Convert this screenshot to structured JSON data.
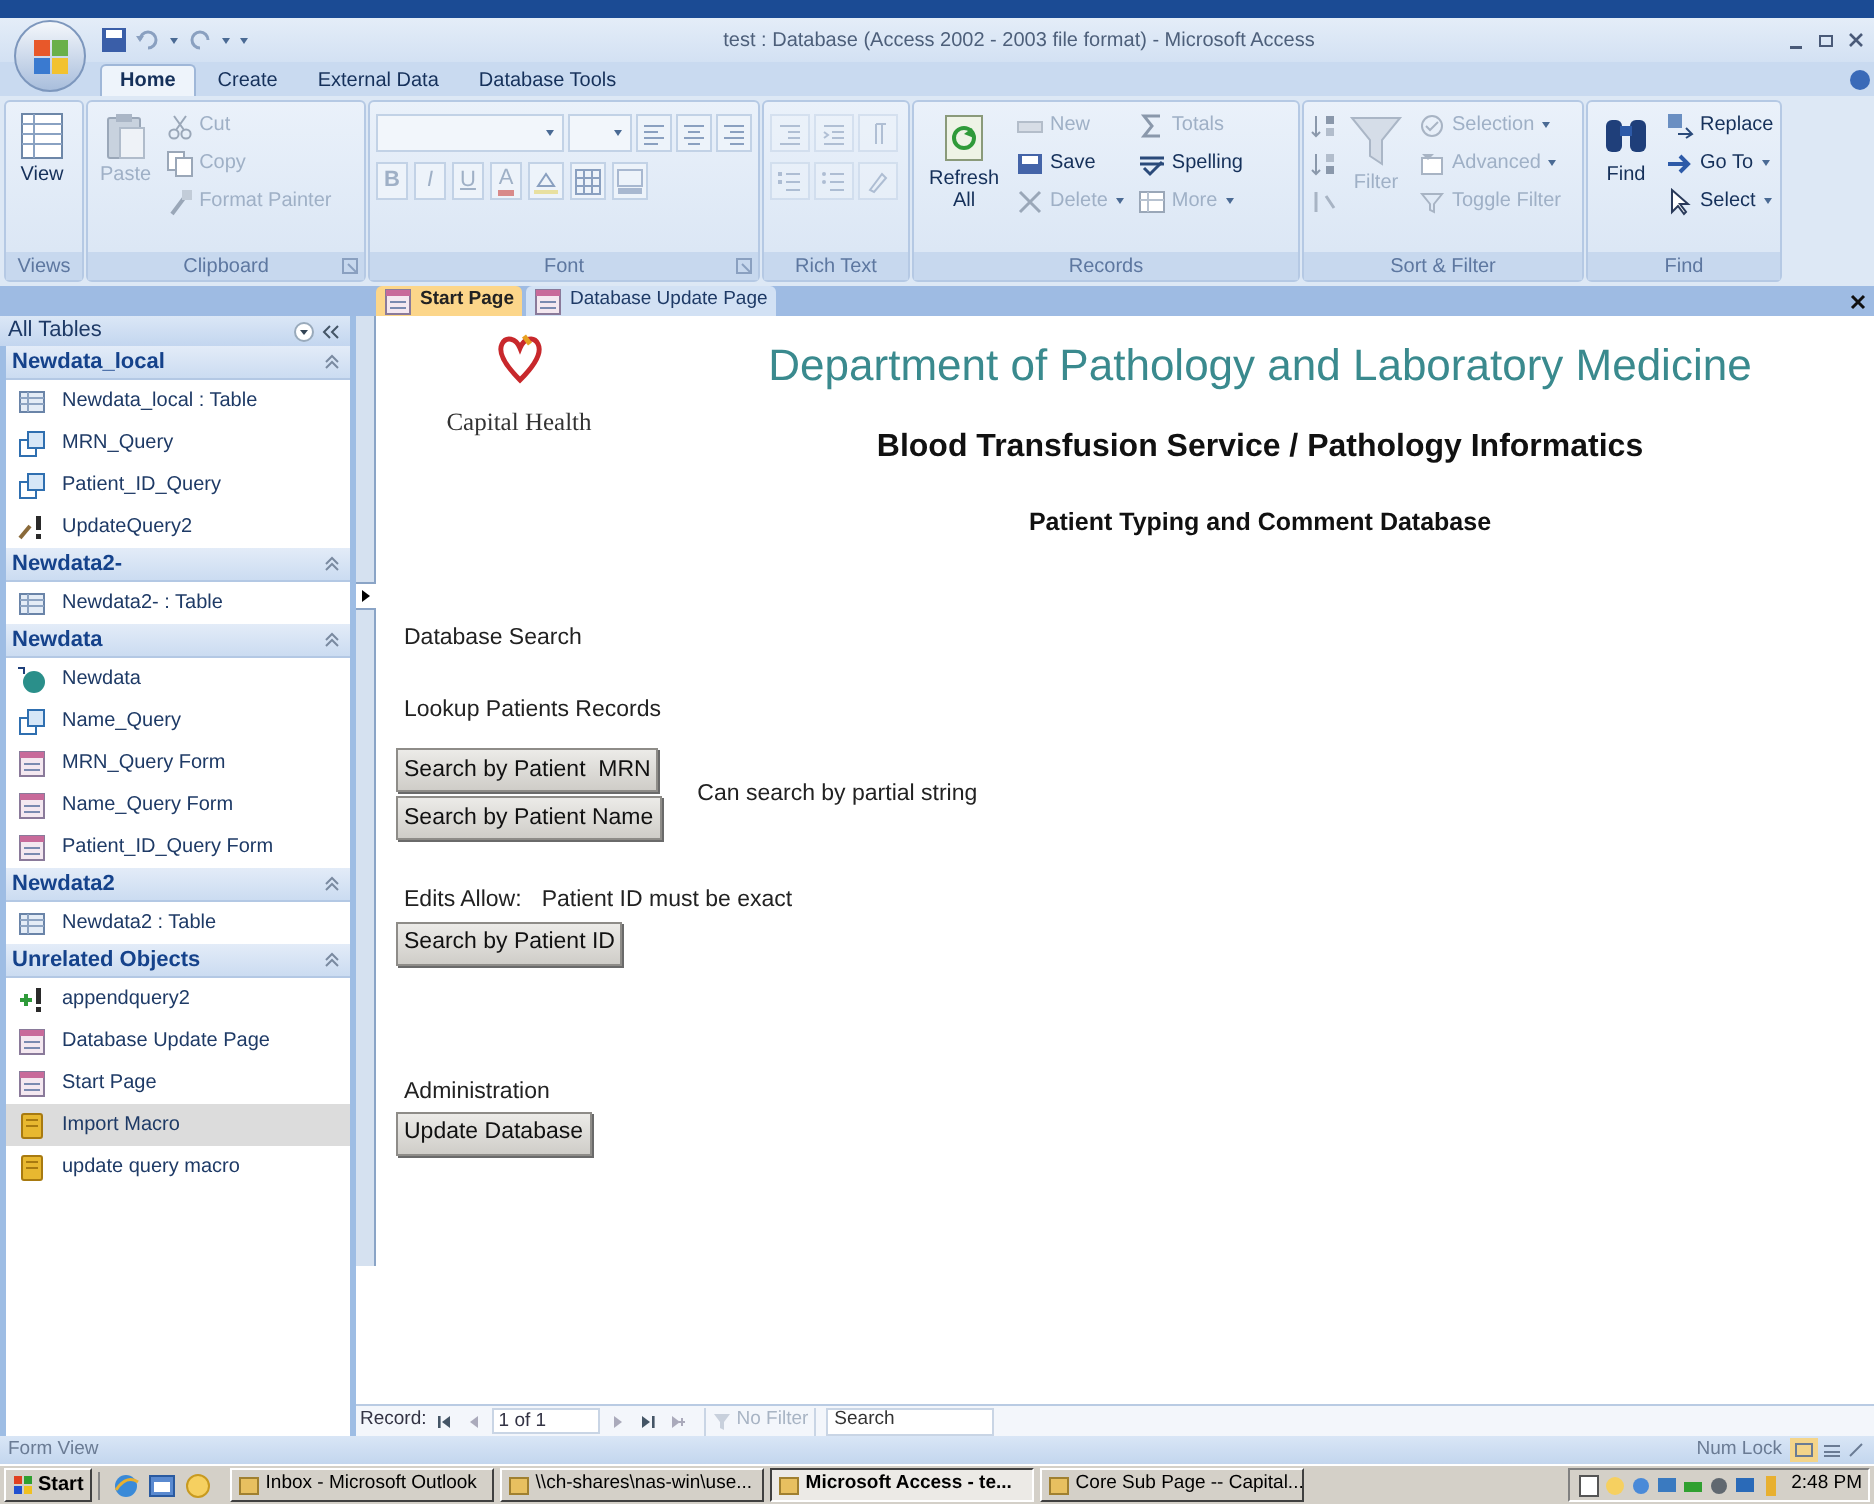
{
  "window": {
    "title": "test : Database (Access 2002 - 2003 file format) - Microsoft Access"
  },
  "ribbon_tabs": [
    {
      "label": "Home",
      "selected": true
    },
    {
      "label": "Create",
      "selected": false
    },
    {
      "label": "External Data",
      "selected": false
    },
    {
      "label": "Database Tools",
      "selected": false
    }
  ],
  "ribbon": {
    "views": {
      "label": "Views",
      "view": {
        "label": "View",
        "disabled": false
      }
    },
    "clipboard": {
      "label": "Clipboard",
      "paste": {
        "label": "Paste",
        "disabled": true
      },
      "cut": {
        "label": "Cut",
        "disabled": true
      },
      "copy": {
        "label": "Copy",
        "disabled": true
      },
      "format_painter": {
        "label": "Format Painter",
        "disabled": true
      }
    },
    "font": {
      "label": "Font",
      "disabled": true,
      "bold": "B",
      "italic": "I",
      "underline": "U",
      "font_color": "A"
    },
    "rich_text": {
      "label": "Rich Text",
      "disabled": true
    },
    "records": {
      "label": "Records",
      "refresh_all": {
        "label": "Refresh All",
        "disabled": false
      },
      "new": {
        "label": "New",
        "disabled": true
      },
      "save": {
        "label": "Save",
        "disabled": false
      },
      "delete": {
        "label": "Delete",
        "disabled": true
      },
      "totals": {
        "label": "Totals",
        "disabled": true
      },
      "spelling": {
        "label": "Spelling",
        "disabled": false
      },
      "more": {
        "label": "More",
        "disabled": true
      }
    },
    "sort_filter": {
      "label": "Sort & Filter",
      "filter": {
        "label": "Filter",
        "disabled": true
      },
      "selection": {
        "label": "Selection",
        "disabled": true
      },
      "advanced": {
        "label": "Advanced",
        "disabled": true
      },
      "toggle_filter": {
        "label": "Toggle Filter",
        "disabled": true
      }
    },
    "find": {
      "label": "Find",
      "find": {
        "label": "Find",
        "disabled": false
      },
      "replace": {
        "label": "Replace",
        "disabled": false
      },
      "go_to": {
        "label": "Go To",
        "disabled": false
      },
      "select": {
        "label": "Select",
        "disabled": false
      }
    }
  },
  "nav": {
    "title": "All Tables",
    "groups": [
      {
        "label": "Newdata_local",
        "expanded": true,
        "items": [
          {
            "kind": "table",
            "label": "Newdata_local : Table",
            "selected": false
          },
          {
            "kind": "query",
            "label": "MRN_Query",
            "selected": false
          },
          {
            "kind": "query",
            "label": "Patient_ID_Query",
            "selected": false
          },
          {
            "kind": "update_query",
            "label": "UpdateQuery2",
            "selected": false
          }
        ]
      },
      {
        "label": "Newdata2-",
        "expanded": true,
        "items": [
          {
            "kind": "table",
            "label": "Newdata2- : Table",
            "selected": false
          }
        ]
      },
      {
        "label": "Newdata",
        "expanded": true,
        "items": [
          {
            "kind": "linked_table",
            "label": "Newdata",
            "selected": false
          },
          {
            "kind": "query",
            "label": "Name_Query",
            "selected": false
          },
          {
            "kind": "form",
            "label": "MRN_Query Form",
            "selected": false
          },
          {
            "kind": "form",
            "label": "Name_Query Form",
            "selected": false
          },
          {
            "kind": "form",
            "label": "Patient_ID_Query Form",
            "selected": false
          }
        ]
      },
      {
        "label": "Newdata2",
        "expanded": true,
        "items": [
          {
            "kind": "table",
            "label": "Newdata2 : Table",
            "selected": false
          }
        ]
      },
      {
        "label": "Unrelated Objects",
        "expanded": true,
        "items": [
          {
            "kind": "append_query",
            "label": "appendquery2",
            "selected": false
          },
          {
            "kind": "form",
            "label": "Database Update Page",
            "selected": false
          },
          {
            "kind": "form",
            "label": "Start Page",
            "selected": false
          },
          {
            "kind": "macro",
            "label": "Import Macro",
            "selected": true
          },
          {
            "kind": "macro",
            "label": "update query macro",
            "selected": false
          }
        ]
      }
    ]
  },
  "doc_tabs": [
    {
      "label": "Start Page",
      "selected": true
    },
    {
      "label": "Database Update Page",
      "selected": false
    }
  ],
  "form": {
    "org": "Capital Health",
    "department": "Department of Pathology and Laboratory Medicine",
    "service": "Blood Transfusion Service / Pathology Informatics",
    "database": "Patient Typing and Comment Database",
    "search_heading": "Database Search",
    "lookup_heading": "Lookup Patients Records",
    "mrn_button": "Search by Patient  MRN",
    "name_button": "Search by Patient Name",
    "partial_note": "Can search by partial string",
    "edits_label": "Edits Allow:",
    "exact_note": "Patient ID must be exact",
    "id_button": "Search by Patient ID",
    "admin_heading": "Administration",
    "update_button": "Update Database"
  },
  "record_nav": {
    "label": "Record:",
    "position": "1 of 1",
    "filter": {
      "label": "No Filter",
      "disabled": true
    },
    "search": {
      "placeholder": "Search"
    }
  },
  "status_bar": {
    "text": "Form View",
    "num_lock": "Num Lock"
  },
  "taskbar": {
    "start": "Start",
    "tasks": [
      {
        "label": "Inbox - Microsoft Outlook",
        "selected": false
      },
      {
        "label": "\\\\ch-shares\\nas-win\\use...",
        "selected": false
      },
      {
        "label": "Microsoft Access - te...",
        "selected": true
      },
      {
        "label": "Core Sub Page -- Capital...",
        "selected": false
      }
    ],
    "clock": "2:48 PM"
  }
}
